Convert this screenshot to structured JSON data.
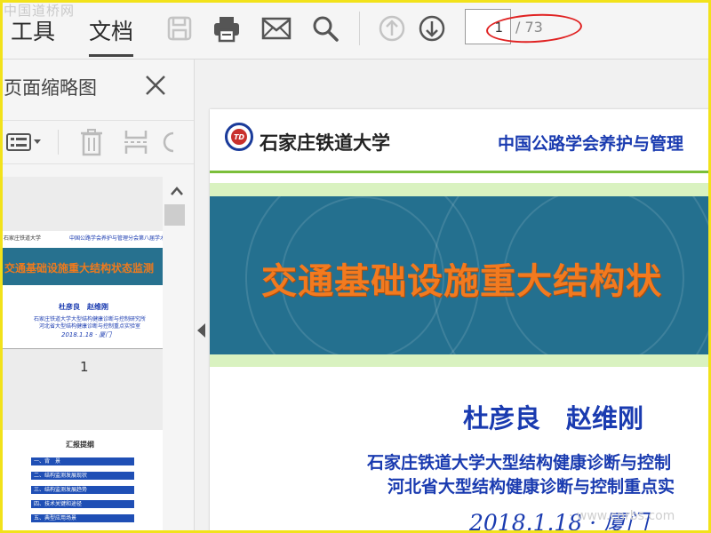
{
  "watermark": {
    "top": "中国道桥网",
    "bottom": "· www.cnrbs.com"
  },
  "toolbar": {
    "tabs": [
      {
        "label": "工具"
      },
      {
        "label": "文档"
      }
    ],
    "icons": [
      "save-icon",
      "print-icon",
      "mail-icon",
      "search-icon",
      "page-up-icon",
      "page-down-icon"
    ],
    "current_page": "1",
    "page_total": "/ 73"
  },
  "panel": {
    "title": "页面缩略图",
    "tool_icons": [
      "options-icon",
      "delete-icon",
      "extract-icon",
      "rotate-icon"
    ],
    "thumbnails": [
      {
        "number": "1",
        "university": "石家庄铁道大学",
        "society": "中国公路学会养护与管理分会第八届学术",
        "title": "交通基础设施重大结构状态监测",
        "authors": "杜彦良　赵维刚",
        "institute_lines": [
          "石家庄铁道大学大型结构健康诊断与控制研究所",
          "河北省大型结构健康诊断与控制重点实验室"
        ],
        "date": "2018.1.18 · 厦门"
      },
      {
        "title": "汇报提纲",
        "items": [
          "一、背　景",
          "二、结构监测发展现状",
          "三、结构监测发展趋势",
          "四、技术关键和途径",
          "五、典型应用场景"
        ]
      }
    ]
  },
  "document": {
    "university": "石家庄铁道大学",
    "logo_text": "TD",
    "society": "中国公路学会养护与管理",
    "title": "交通基础设施重大结构状",
    "authors": "杜彦良　赵维刚",
    "institute_1": "石家庄铁道大学大型结构健康诊断与控制",
    "institute_2": "河北省大型结构健康诊断与控制重点实",
    "date": "2018.1.18 · 厦门"
  },
  "colors": {
    "accent_blue": "#1a3bb0",
    "band_blue": "#24708f",
    "title_orange": "#f27a1f",
    "band_green": "#d9f2c0",
    "annotation_red": "#e02222"
  }
}
